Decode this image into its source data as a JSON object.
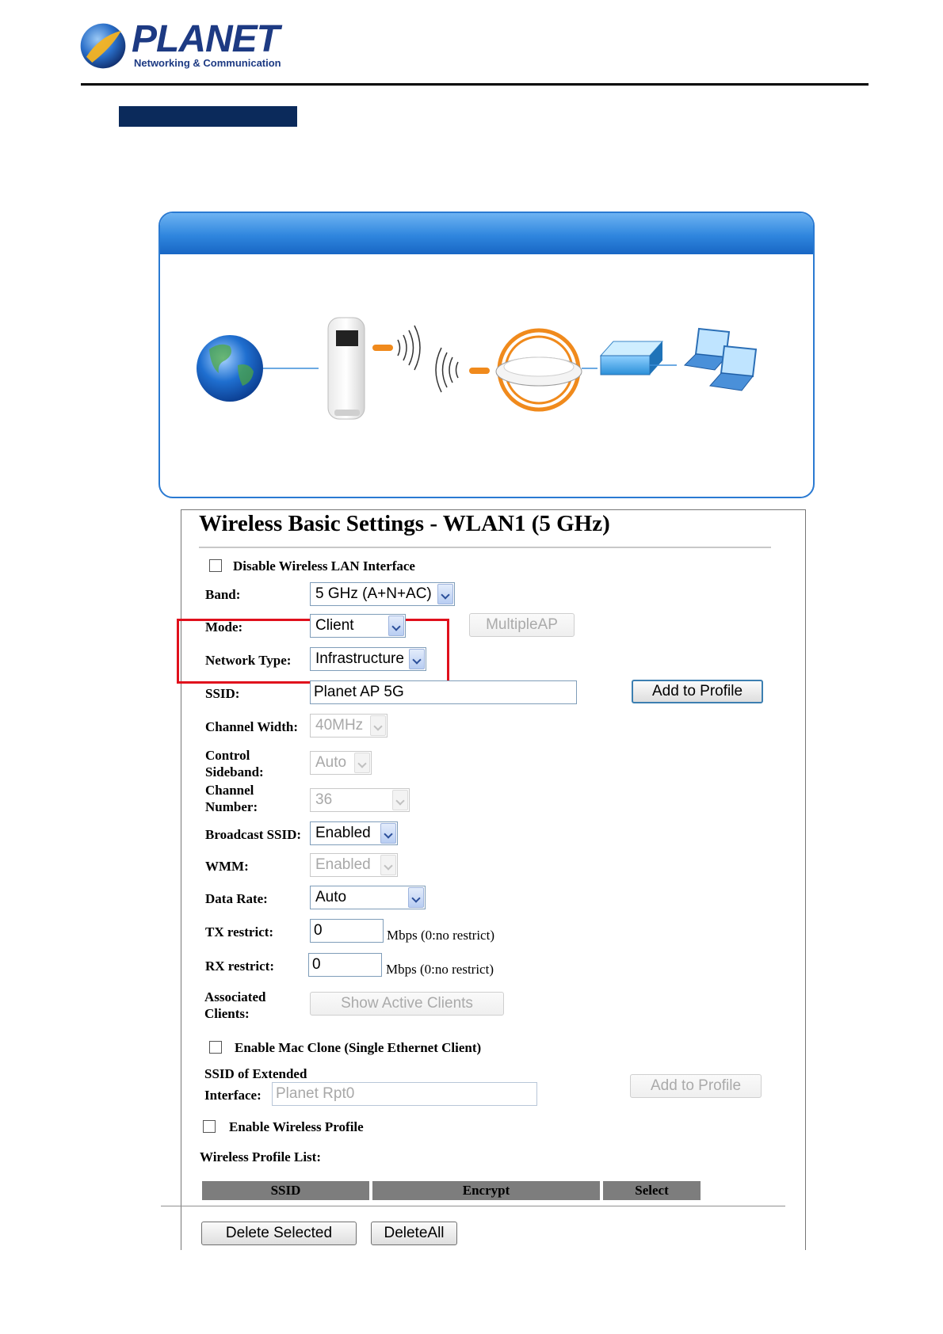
{
  "header": {
    "brand": "PLANET",
    "tagline": "Networking & Communication"
  },
  "settings": {
    "title": "Wireless Basic Settings - WLAN1 (5 GHz)",
    "disable_wlan_label": "Disable Wireless LAN Interface",
    "disable_wlan_checked": false,
    "band_label": "Band:",
    "band_value": "5 GHz (A+N+AC)",
    "mode_label": "Mode:",
    "mode_value": "Client",
    "multiple_ap_button": "MultipleAP",
    "network_type_label": "Network Type:",
    "network_type_value": "Infrastructure",
    "ssid_label": "SSID:",
    "ssid_value": "Planet AP 5G",
    "add_to_profile_button": "Add to Profile",
    "channel_width_label": "Channel Width:",
    "channel_width_value": "40MHz",
    "control_sideband_label_1": "Control",
    "control_sideband_label_2": "Sideband:",
    "control_sideband_value": "Auto",
    "channel_number_label_1": "Channel",
    "channel_number_label_2": "Number:",
    "channel_number_value": "36",
    "broadcast_ssid_label": "Broadcast SSID:",
    "broadcast_ssid_value": "Enabled",
    "wmm_label": "WMM:",
    "wmm_value": "Enabled",
    "data_rate_label": "Data Rate:",
    "data_rate_value": "Auto",
    "tx_restrict_label": "TX restrict:",
    "tx_restrict_value": "0",
    "tx_restrict_unit": "Mbps (0:no restrict)",
    "rx_restrict_label": "RX restrict:",
    "rx_restrict_value": "0",
    "rx_restrict_unit": "Mbps (0:no restrict)",
    "associated_clients_label_1": "Associated",
    "associated_clients_label_2": "Clients:",
    "show_active_clients_button": "Show Active Clients",
    "mac_clone_label": "Enable Mac Clone (Single Ethernet Client)",
    "mac_clone_checked": false,
    "ssid_extended_label_1": "SSID of Extended",
    "ssid_extended_label_2": "Interface:",
    "ssid_extended_value": "Planet Rpt0",
    "add_to_profile_button_2": "Add to Profile",
    "enable_profile_label": "Enable Wireless Profile",
    "enable_profile_checked": false,
    "profile_list_label": "Wireless Profile List:",
    "profile_table_headers": [
      "SSID",
      "Encrypt",
      "Select"
    ],
    "delete_selected_button": "Delete Selected",
    "delete_all_button": "DeleteAll"
  },
  "colors": {
    "brand_blue": "#1d3a83",
    "section_bar": "#0b2a5b",
    "panel_blue": "#2f86de",
    "highlight_red": "#e0101c",
    "signal_orange": "#f08a1c"
  }
}
